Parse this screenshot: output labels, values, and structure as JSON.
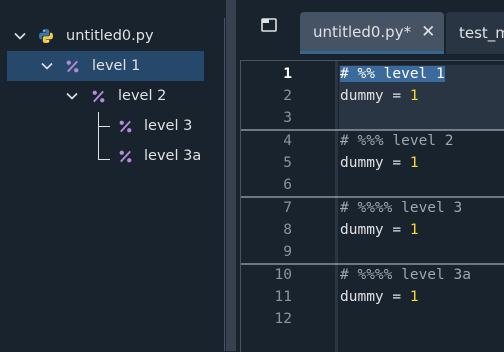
{
  "outline": {
    "items": [
      {
        "label": "untitled0.py"
      },
      {
        "label": "level 1"
      },
      {
        "label": "level 2"
      },
      {
        "label": "level 3"
      },
      {
        "label": "level 3a"
      }
    ]
  },
  "tabs": [
    {
      "label": "untitled0.py*",
      "close": "✕"
    },
    {
      "label": "test_m"
    }
  ],
  "editor": {
    "lines": [
      {
        "n": "1",
        "comment": "# %% ",
        "selected": "level 1"
      },
      {
        "n": "2",
        "var": "dummy",
        "op": " = ",
        "value": "1"
      },
      {
        "n": "3"
      },
      {
        "n": "4",
        "comment": "# %%% level 2"
      },
      {
        "n": "5",
        "var": "dummy",
        "op": " = ",
        "value": "1"
      },
      {
        "n": "6"
      },
      {
        "n": "7",
        "comment": "# %%%% level 3"
      },
      {
        "n": "8",
        "var": "dummy",
        "op": " = ",
        "value": "1"
      },
      {
        "n": "9"
      },
      {
        "n": "10",
        "comment": "# %%%% level 3a"
      },
      {
        "n": "11",
        "var": "dummy",
        "op": " = ",
        "value": "1"
      },
      {
        "n": "12"
      }
    ]
  },
  "colors": {
    "accent": "#346792",
    "selection": "#26486b",
    "number": "#fdd835"
  }
}
